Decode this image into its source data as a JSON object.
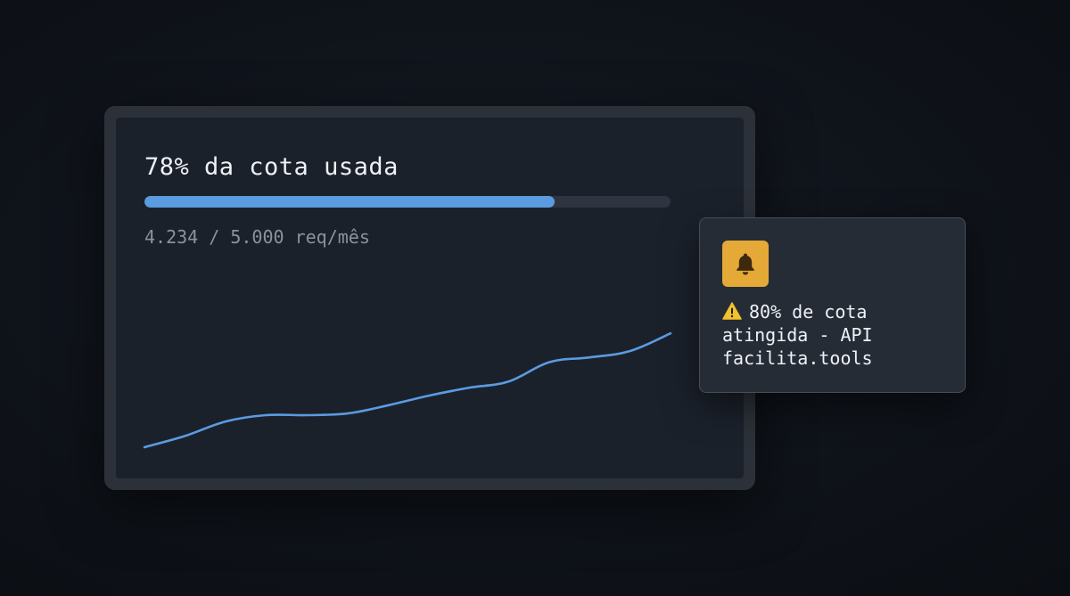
{
  "usage": {
    "title": "78% da cota usada",
    "progress_fraction": 0.78,
    "detail": "4.234 / 5.000 req/mês"
  },
  "chart_data": {
    "type": "line",
    "series": [
      {
        "values": [
          0,
          0.07,
          0.16,
          0.2,
          0.2,
          0.21,
          0.26,
          0.32,
          0.37,
          0.41,
          0.53,
          0.56,
          0.6,
          0.71
        ]
      }
    ]
  },
  "notification": {
    "icon": "bell-icon",
    "warning_icon": "warning-icon",
    "message": "80% de cota atingida - API facilita.tools"
  },
  "colors": {
    "accent": "#5b9be0",
    "warning": "#e5a937",
    "background": "#0f131a",
    "panel": "#1b212b",
    "text": "#eef1f5",
    "muted": "#8a929e"
  }
}
